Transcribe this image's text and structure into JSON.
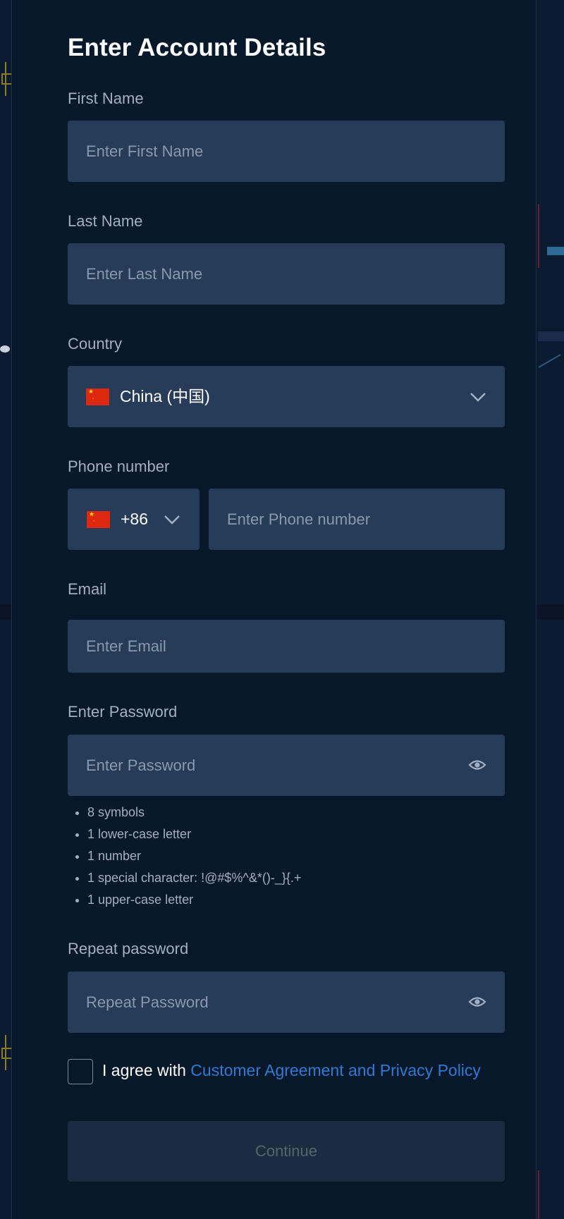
{
  "title": "Enter Account Details",
  "first_name": {
    "label": "First Name",
    "placeholder": "Enter First Name"
  },
  "last_name": {
    "label": "Last Name",
    "placeholder": "Enter Last Name"
  },
  "country": {
    "label": "Country",
    "value": "China (中国)",
    "flag": "china-flag-icon"
  },
  "phone": {
    "label": "Phone number",
    "code": "+86",
    "placeholder": "Enter Phone number",
    "flag": "china-flag-icon"
  },
  "email": {
    "label": "Email",
    "placeholder": "Enter Email"
  },
  "password": {
    "label": "Enter Password",
    "placeholder": "Enter Password",
    "rules": [
      "8 symbols",
      "1 lower-case letter",
      "1 number",
      "1 special character: !@#$%^&*()-_}{.+",
      "1 upper-case letter"
    ]
  },
  "repeat_password": {
    "label": "Repeat password",
    "placeholder": "Repeat Password"
  },
  "agreement": {
    "text": "I agree with ",
    "link": "Customer Agreement and Privacy Policy"
  },
  "continue_label": "Continue",
  "colors": {
    "panel_bg": "#08182b",
    "field_bg": "#263c59",
    "link": "#2f7ad1",
    "button_disabled_bg": "#1b2b40"
  }
}
